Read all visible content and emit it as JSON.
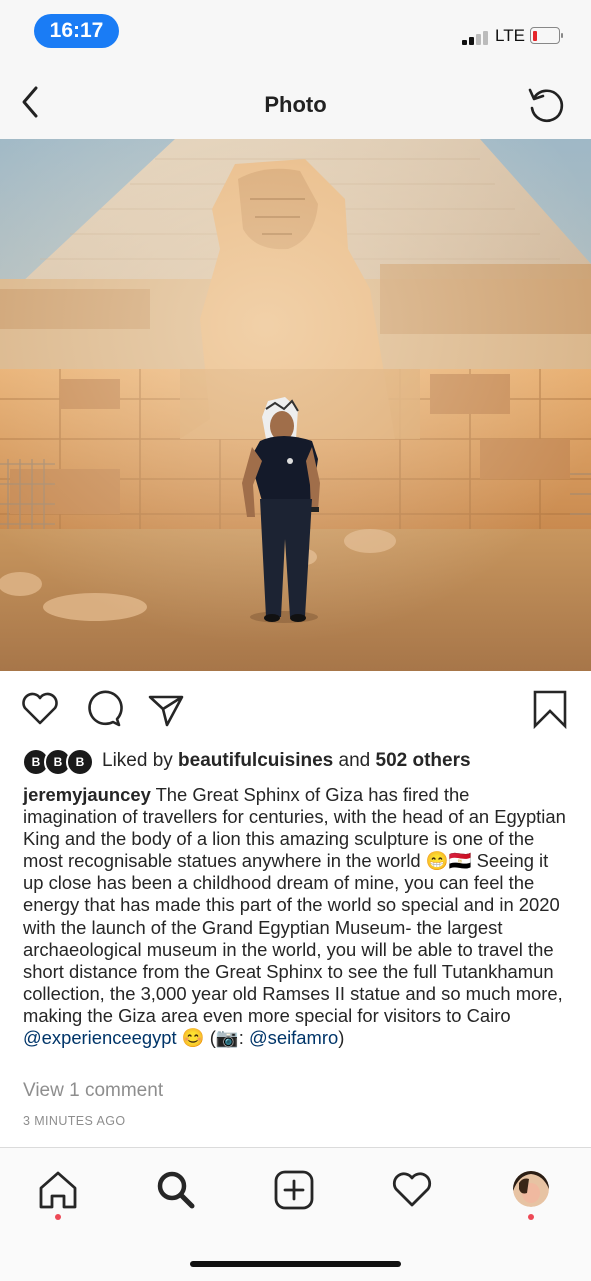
{
  "status_bar": {
    "time": "16:17",
    "network": "LTE"
  },
  "nav": {
    "title": "Photo",
    "back_icon": "chevron-left-icon",
    "refresh_icon": "refresh-icon"
  },
  "photo": {
    "subject": "man-at-sphinx-photo"
  },
  "actions": {
    "like_icon": "heart-icon",
    "comment_icon": "comment-icon",
    "share_icon": "paper-plane-icon",
    "save_icon": "bookmark-icon"
  },
  "likes": {
    "avatar_letter": "B",
    "prefix": "Liked by ",
    "user": "beautifulcuisines",
    "middle": " and ",
    "others": "502 others"
  },
  "caption": {
    "username": "jeremyjauncey",
    "text_part1": " The Great Sphinx of Giza has fired the imagination of travellers for centuries, with the head of an Egyptian King and the body of a lion this amazing sculpture is one of the most recognisable statues anywhere in the world 😁🇪🇬 Seeing it up close has been a childhood dream of mine, you can feel the energy that has made this part of the world so special and in 2020 with the launch of the Grand Egyptian Museum- the largest archaeological museum in the world, you will be able to travel the short distance from the Great Sphinx to see the full Tutankhamun collection, the 3,000 year old Ramses II statue and so much more, making the Giza area even more special for visitors to Cairo ",
    "mention1": "@experienceegypt",
    "text_part2": " 😊 (📷: ",
    "mention2": "@seifamro",
    "text_part3": ")"
  },
  "comments_link": "View 1 comment",
  "timestamp": "3 MINUTES AGO",
  "tabbar": {
    "items": [
      "home-icon",
      "search-icon",
      "add-post-icon",
      "activity-heart-icon",
      "profile-avatar"
    ],
    "notification_color": "#ed4956"
  },
  "colors": {
    "accent": "#1a7cf5",
    "link": "#003569",
    "muted": "#8e8e8e"
  }
}
